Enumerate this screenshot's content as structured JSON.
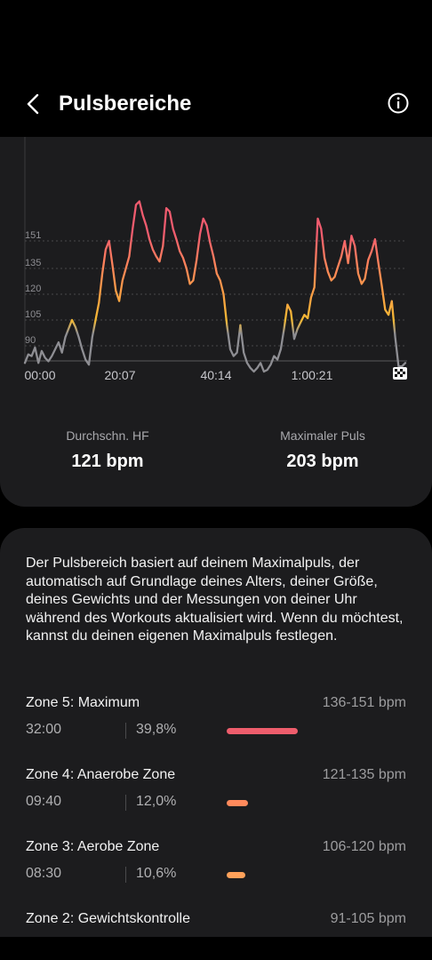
{
  "header": {
    "title": "Pulsbereiche"
  },
  "chart_data": {
    "type": "line",
    "y_ticks": [
      "151",
      "135",
      "120",
      "105",
      "90"
    ],
    "x_ticks": [
      "00:00",
      "20:07",
      "40:14",
      "1:00:21"
    ],
    "series": [
      {
        "values": [
          80,
          85,
          84,
          89,
          80,
          87,
          83,
          81,
          84,
          88,
          92,
          86,
          95,
          100,
          105,
          101,
          95,
          88,
          82,
          79,
          95,
          105,
          115,
          132,
          146,
          151,
          137,
          122,
          116,
          128,
          135,
          142,
          158,
          172,
          174,
          166,
          160,
          152,
          146,
          142,
          139,
          148,
          170,
          168,
          158,
          152,
          145,
          141,
          135,
          126,
          128,
          140,
          155,
          164,
          160,
          150,
          142,
          132,
          128,
          120,
          102,
          88,
          84,
          86,
          102,
          86,
          80,
          77,
          75,
          77,
          80,
          75,
          76,
          79,
          84,
          82,
          88,
          100,
          114,
          110,
          94,
          100,
          104,
          108,
          106,
          118,
          124,
          164,
          158,
          141,
          133,
          128,
          130,
          136,
          142,
          151,
          138,
          154,
          148,
          132,
          126,
          129,
          140,
          145,
          152,
          138,
          125,
          111,
          108,
          116,
          95,
          78,
          78,
          80
        ]
      }
    ]
  },
  "stats": {
    "avg_label": "Durchschn. HF",
    "avg_value": "121",
    "avg_unit": "bpm",
    "max_label": "Maximaler Puls",
    "max_value": "203",
    "max_unit": "bpm"
  },
  "description": "Der Pulsbereich basiert auf deinem Maximalpuls, der automatisch auf Grundlage deines Alters, deiner Größe, deines Gewichts und der Messungen von deiner Uhr während des Workouts aktualisiert wird. Wenn du möchtest, kannst du deinen eigenen Maximalpuls festlegen.",
  "zones": [
    {
      "name": "Zone 5: Maximum",
      "range": "136-151 bpm",
      "time": "32:00",
      "percent": "39,8%",
      "fraction": 0.398,
      "color": "#ee5d6c"
    },
    {
      "name": "Zone 4: Anaerobe Zone",
      "range": "121-135 bpm",
      "time": "09:40",
      "percent": "12,0%",
      "fraction": 0.12,
      "color": "#ff8a5c"
    },
    {
      "name": "Zone 3: Aerobe Zone",
      "range": "106-120 bpm",
      "time": "08:30",
      "percent": "10,6%",
      "fraction": 0.106,
      "color": "#ffa15a"
    },
    {
      "name": "Zone 2: Gewichtskontrolle",
      "range": "91-105 bpm",
      "time": "",
      "percent": "",
      "fraction": 0,
      "color": "#ffc23a"
    }
  ],
  "colors": {
    "zone1": "#8e8e93",
    "zone2": "#f2b834",
    "zone3": "#fb9e45",
    "zone4": "#fc7e5e",
    "zone5": "#ef5b6e"
  }
}
